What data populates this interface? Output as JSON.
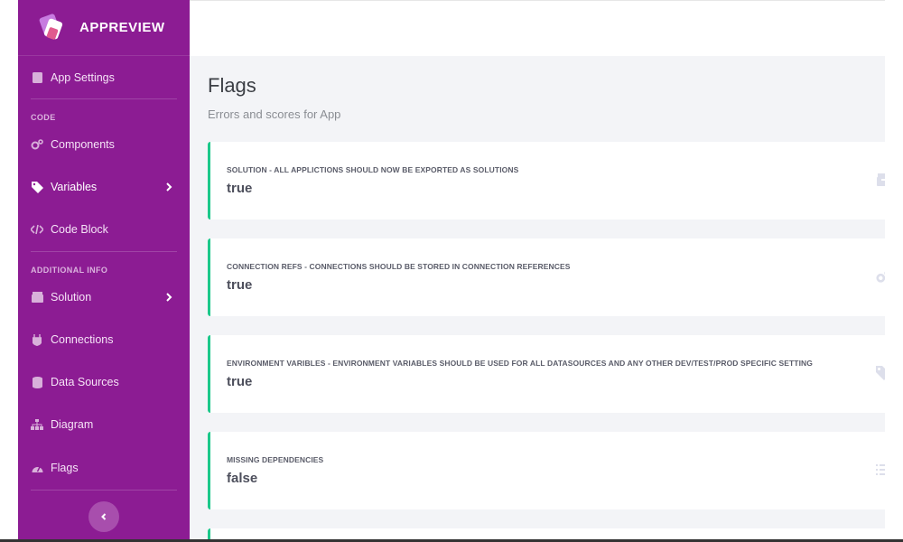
{
  "brand": {
    "name": "APPREVIEW"
  },
  "sidebar": {
    "items": [
      {
        "label": "App Settings",
        "icon": "square-icon"
      },
      {
        "label": "Components",
        "icon": "cogs-icon"
      },
      {
        "label": "Variables",
        "icon": "tag-icon"
      },
      {
        "label": "Code Block",
        "icon": "code-icon"
      },
      {
        "label": "Solution",
        "icon": "box-icon"
      },
      {
        "label": "Connections",
        "icon": "plug-icon"
      },
      {
        "label": "Data Sources",
        "icon": "database-icon"
      },
      {
        "label": "Diagram",
        "icon": "sitemap-icon"
      },
      {
        "label": "Flags",
        "icon": "gauge-icon"
      }
    ],
    "headings": {
      "code": "CODE",
      "additional": "ADDITIONAL INFO"
    }
  },
  "page": {
    "title": "Flags",
    "subtitle": "Errors and scores for App"
  },
  "flags": [
    {
      "label": "SOLUTION - ALL APPLICTIONS SHOULD NOW BE EXPORTED AS SOLUTIONS",
      "value": "true",
      "icon": "box-icon"
    },
    {
      "label": "CONNECTION REFS - CONNECTIONS SHOULD BE STORED IN CONNECTION REFERENCES",
      "value": "true",
      "icon": "cogs-icon"
    },
    {
      "label": "ENVIRONMENT VARIBLES - ENVIRONMENT VARIABLES SHOULD BE USED FOR ALL DATASOURCES AND ANY OTHER DEV/TEST/PROD SPECIFIC SETTING",
      "value": "true",
      "icon": "tag-icon"
    },
    {
      "label": "MISSING DEPENDENCIES",
      "value": "false",
      "icon": "list-icon"
    }
  ],
  "colors": {
    "sidebar": "#8c1c93",
    "accent": "#1cc88a",
    "background": "#f3f4f7"
  }
}
